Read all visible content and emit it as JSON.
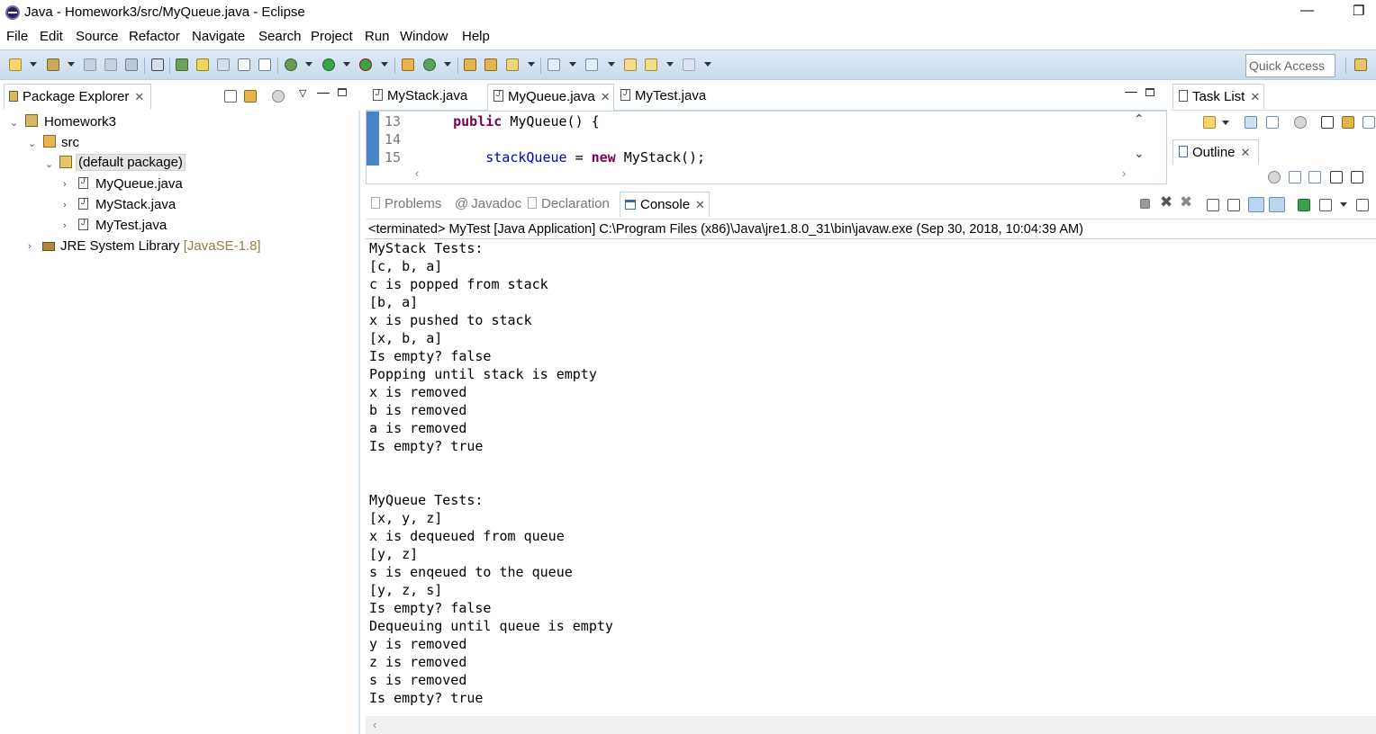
{
  "window": {
    "title": "Java - Homework3/src/MyQueue.java - Eclipse",
    "minimize": "—",
    "restore": "❐"
  },
  "menu": [
    "File",
    "Edit",
    "Source",
    "Refactor",
    "Navigate",
    "Search",
    "Project",
    "Run",
    "Window",
    "Help"
  ],
  "toolbar": {
    "quick_access_placeholder": "Quick Access"
  },
  "package_explorer": {
    "tab_label": "Package Explorer",
    "tree": {
      "project": "Homework3",
      "src": "src",
      "package": "(default package)",
      "files": [
        "MyQueue.java",
        "MyStack.java",
        "MyTest.java"
      ],
      "jre_label": "JRE System Library",
      "jre_version": "[JavaSE-1.8]"
    }
  },
  "editor": {
    "tabs": [
      "MyStack.java",
      "MyQueue.java",
      "MyTest.java"
    ],
    "active_tab": "MyQueue.java",
    "lines": [
      {
        "num": "13",
        "kw": "public",
        "rest": " MyQueue() {"
      },
      {
        "num": "14",
        "text": ""
      },
      {
        "num": "15",
        "field": "stackQueue",
        "op": " = ",
        "kw": "new",
        "rest": " MyStack();"
      }
    ]
  },
  "task_list": {
    "tab_label": "Task List"
  },
  "outline": {
    "tab_label": "Outline"
  },
  "console": {
    "tabs": [
      "Problems",
      "Javadoc",
      "Declaration",
      "Console"
    ],
    "active_tab": "Console",
    "header": "<terminated> MyTest [Java Application] C:\\Program Files (x86)\\Java\\jre1.8.0_31\\bin\\javaw.exe (Sep 30, 2018, 10:04:39 AM)",
    "output": [
      "MyStack Tests:",
      "[c, b, a]",
      "c is popped from stack",
      "[b, a]",
      "x is pushed to stack",
      "[x, b, a]",
      "Is empty? false",
      "Popping until stack is empty",
      "x is removed",
      "b is removed",
      "a is removed",
      "Is empty? true",
      "",
      "",
      "MyQueue Tests:",
      "[x, y, z]",
      "x is dequeued from queue",
      "[y, z]",
      "s is enqeued to the queue",
      "[y, z, s]",
      "Is empty? false",
      "Dequeuing until queue is empty",
      "y is removed",
      "z is removed",
      "s is removed",
      "Is empty? true"
    ]
  }
}
